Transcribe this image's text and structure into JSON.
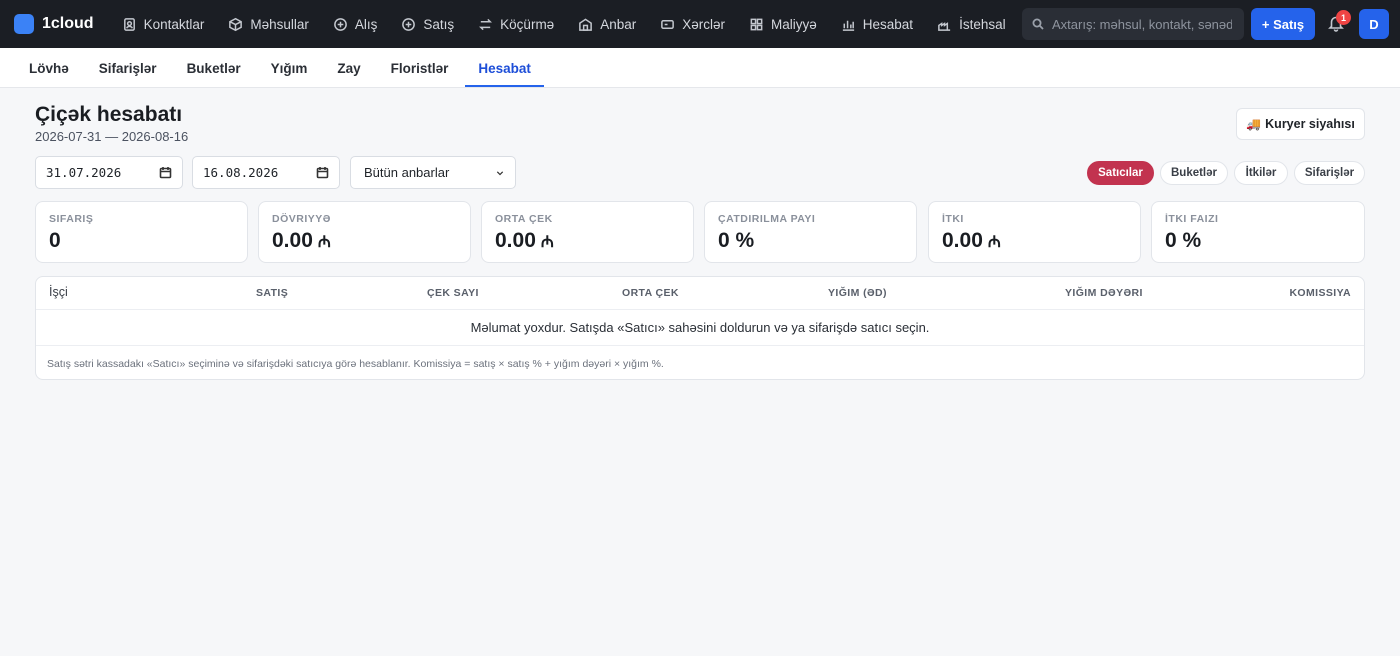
{
  "app": {
    "name": "1cloud"
  },
  "topnav": {
    "items": [
      {
        "label": "Kontaktlar",
        "icon": "contacts-icon"
      },
      {
        "label": "Məhsullar",
        "icon": "box-icon"
      },
      {
        "label": "Alış",
        "icon": "plus-circle-icon"
      },
      {
        "label": "Satış",
        "icon": "plus-circle-icon"
      },
      {
        "label": "Köçürmə",
        "icon": "transfer-icon"
      },
      {
        "label": "Anbar",
        "icon": "warehouse-icon"
      },
      {
        "label": "Xərclər",
        "icon": "wallet-icon"
      },
      {
        "label": "Maliyyə",
        "icon": "grid-icon"
      },
      {
        "label": "Hesabat",
        "icon": "bar-chart-icon"
      },
      {
        "label": "İstehsal",
        "icon": "factory-icon"
      }
    ],
    "search_placeholder": "Axtarış: məhsul, kontakt, sənəd...",
    "sale_button": "+ Satış",
    "notification_count": "1",
    "avatar_initial": "D"
  },
  "subnav": {
    "tabs": [
      {
        "label": "Lövhə",
        "active": false
      },
      {
        "label": "Sifarişlər",
        "active": false
      },
      {
        "label": "Buketlər",
        "active": false
      },
      {
        "label": "Yığım",
        "active": false
      },
      {
        "label": "Zay",
        "active": false
      },
      {
        "label": "Floristlər",
        "active": false
      },
      {
        "label": "Hesabat",
        "active": true
      }
    ]
  },
  "header": {
    "title": "Çiçək hesabatı",
    "range": "2026-07-31 — 2026-08-16",
    "courier_button": "Kuryer siyahısı"
  },
  "filters": {
    "date_from": "31.07.2026",
    "date_to": "16.08.2026",
    "warehouse": "Bütün anbarlar",
    "views": [
      {
        "label": "Satıcılar",
        "active": true
      },
      {
        "label": "Buketlər",
        "active": false
      },
      {
        "label": "İtkilər",
        "active": false
      },
      {
        "label": "Sifarişlər",
        "active": false
      }
    ]
  },
  "kpis": [
    {
      "label": "Sifariş",
      "value": "0",
      "currency": ""
    },
    {
      "label": "Dövriyyə",
      "value": "0.00",
      "currency": "₼"
    },
    {
      "label": "Orta çek",
      "value": "0.00",
      "currency": "₼"
    },
    {
      "label": "Çatdırılma payı",
      "value": "0 %",
      "currency": ""
    },
    {
      "label": "İtki",
      "value": "0.00",
      "currency": "₼"
    },
    {
      "label": "İtki faizi",
      "value": "0 %",
      "currency": ""
    }
  ],
  "table": {
    "columns": [
      "İşçi",
      "Satış",
      "Çek sayı",
      "Orta çek",
      "Yığım (əd)",
      "Yığım dəyəri",
      "Komissiya"
    ],
    "empty_message": "Məlumat yoxdur. Satışda «Satıcı» sahəsini doldurun və ya sifarişdə satıcı seçin.",
    "footnote": "Satış sətri kassadakı «Satıcı» seçiminə və sifarişdəki satıcıya görə hesablanır. Komissiya = satış × satış % + yığım dəyəri × yığım %."
  }
}
